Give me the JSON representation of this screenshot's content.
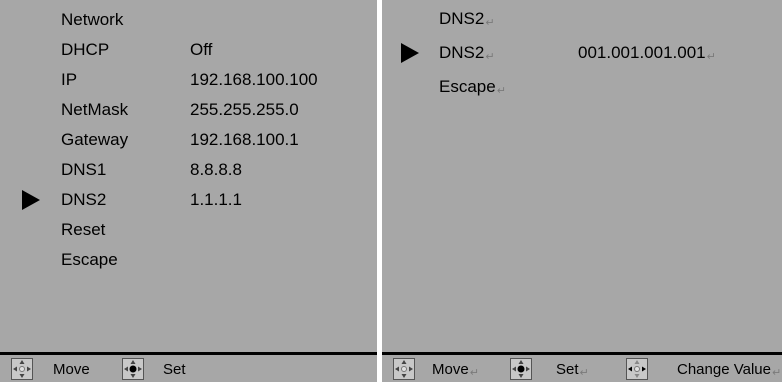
{
  "left_menu": {
    "title": "Network",
    "items": [
      {
        "label": "DHCP",
        "value": "Off"
      },
      {
        "label": "IP",
        "value": "192.168.100.100"
      },
      {
        "label": "NetMask",
        "value": "255.255.255.0"
      },
      {
        "label": "Gateway",
        "value": "192.168.100.1"
      },
      {
        "label": "DNS1",
        "value": "8.8.8.8"
      },
      {
        "label": "DNS2",
        "value": "1.1.1.1",
        "selected": true
      },
      {
        "label": "Reset",
        "value": ""
      },
      {
        "label": "Escape",
        "value": ""
      }
    ],
    "footer": {
      "move_label": "Move",
      "set_label": "Set"
    }
  },
  "right_menu": {
    "title": "DNS2",
    "items": [
      {
        "label": "DNS2",
        "value": "001.001.001.001",
        "selected": true
      },
      {
        "label": "Escape",
        "value": ""
      }
    ],
    "footer": {
      "move_label": "Move",
      "set_label": "Set",
      "change_label": "Change Value"
    }
  },
  "colors": {
    "background": "#a7a7a7",
    "text": "#000000",
    "divider": "#000000"
  },
  "icons": {
    "move": "dpad-move-icon",
    "set": "dpad-set-icon",
    "change": "dpad-change-icon"
  }
}
